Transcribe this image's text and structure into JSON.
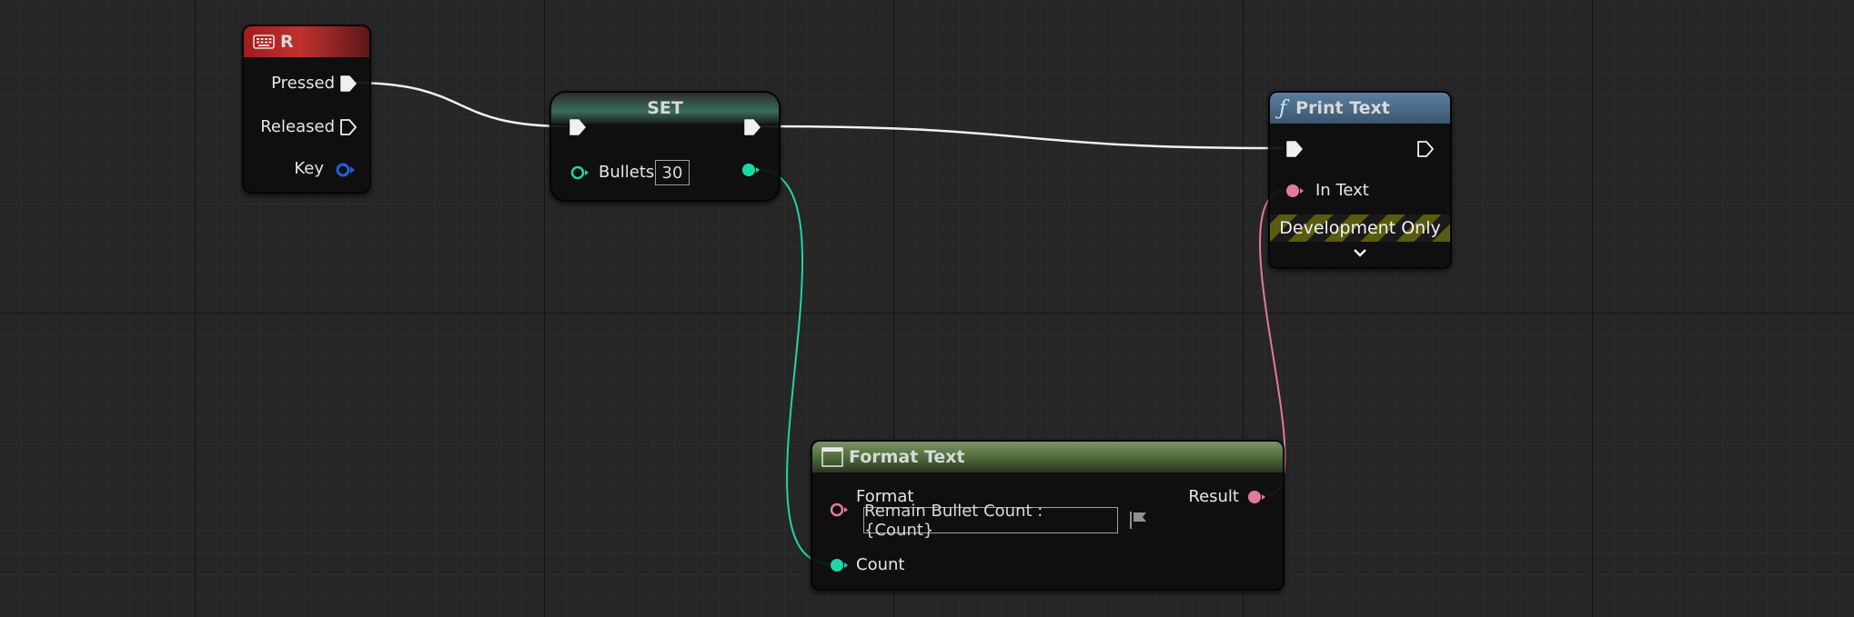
{
  "colors": {
    "exec_wire": "#f0f0f0",
    "int_wire": "#1fd6a6",
    "text_wire": "#e27aa0",
    "event_header": "#a01c1c",
    "set_header": "#3f7d66",
    "print_header": "#44607d",
    "format_header": "#5d7a4a",
    "struct_pin": "#2060d8"
  },
  "key_node": {
    "title": "R",
    "icon": "keyboard-icon",
    "pins": {
      "pressed": "Pressed",
      "released": "Released",
      "key": "Key"
    }
  },
  "set_node": {
    "title": "SET",
    "var_label": "Bullets",
    "value": "30"
  },
  "print_node": {
    "title": "Print Text",
    "icon": "function-icon",
    "in_text_label": "In Text",
    "dev_banner": "Development Only",
    "expand_icon": "chevron-down-icon"
  },
  "format_node": {
    "title": "Format Text",
    "icon": "node-icon",
    "format_label": "Format",
    "format_value": "Remain Bullet Count : {Count}",
    "result_label": "Result",
    "count_label": "Count",
    "flag_icon": "flag-icon"
  }
}
